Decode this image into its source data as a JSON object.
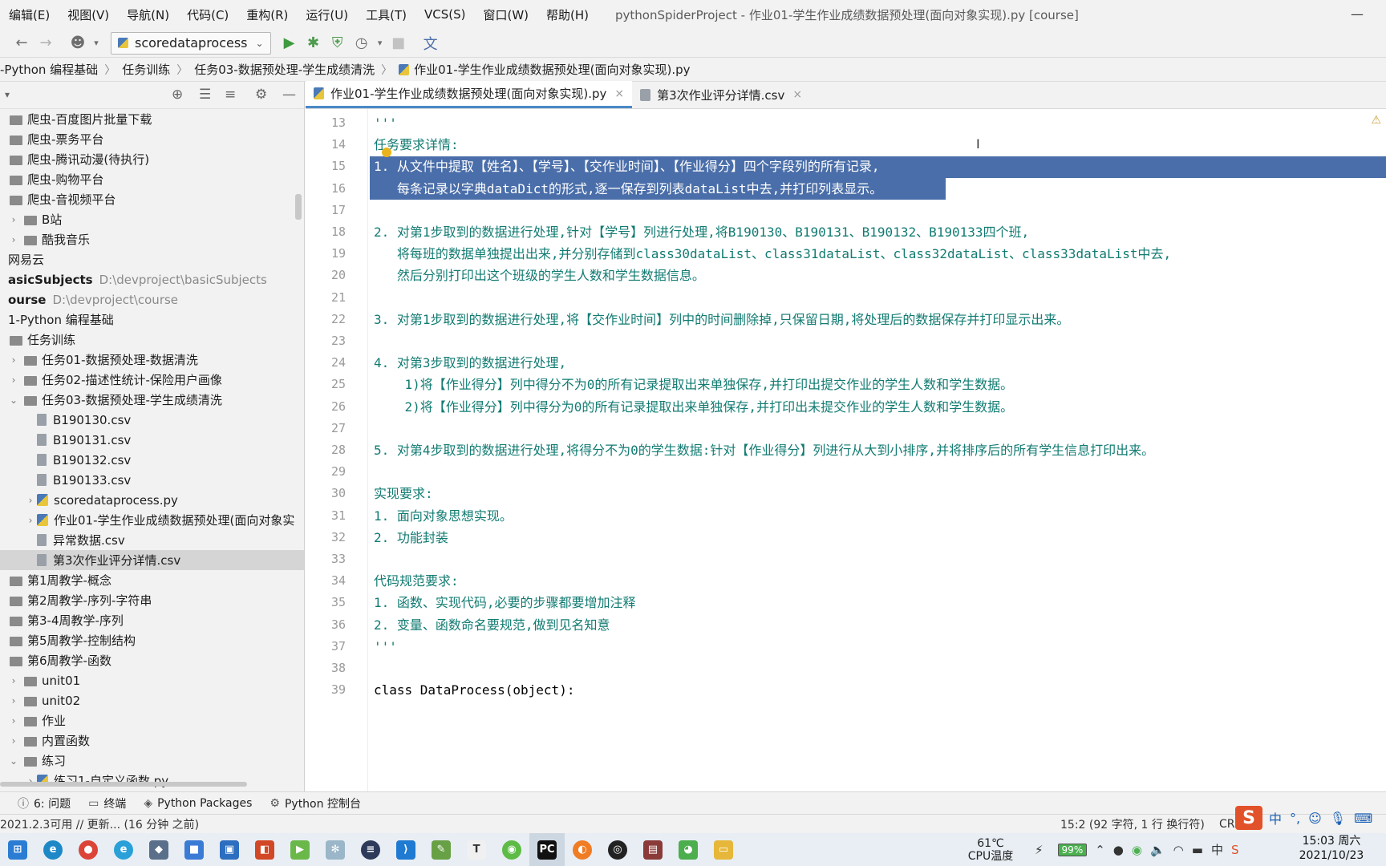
{
  "menubar": {
    "items": [
      "编辑(E)",
      "视图(V)",
      "导航(N)",
      "代码(C)",
      "重构(R)",
      "运行(U)",
      "工具(T)",
      "VCS(S)",
      "窗口(W)",
      "帮助(H)"
    ],
    "title": "pythonSpiderProject - 作业01-学生作业成绩数据预处理(面向对象实现).py [course]",
    "minimize": "—"
  },
  "toolbar": {
    "run_config": "scoredataprocess"
  },
  "breadcrumb": [
    "-Python 编程基础",
    "任务训练",
    "任务03-数据预处理-学生成绩清洗",
    "作业01-学生作业成绩数据预处理(面向对象实现).py"
  ],
  "project_tree": [
    {
      "label": "爬虫-百度图片批量下载",
      "indent": 0,
      "type": "folder",
      "arrow": ""
    },
    {
      "label": "爬虫-票务平台",
      "indent": 0,
      "type": "folder",
      "arrow": ""
    },
    {
      "label": "爬虫-腾讯动漫(待执行)",
      "indent": 0,
      "type": "folder",
      "arrow": ""
    },
    {
      "label": "爬虫-购物平台",
      "indent": 0,
      "type": "folder",
      "arrow": ""
    },
    {
      "label": "爬虫-音视频平台",
      "indent": 0,
      "type": "folder",
      "arrow": ""
    },
    {
      "label": "B站",
      "indent": 1,
      "type": "folder",
      "arrow": "›"
    },
    {
      "label": "酷我音乐",
      "indent": 1,
      "type": "folder",
      "arrow": "›"
    },
    {
      "label": "网易云",
      "indent": 0,
      "type": "plain",
      "arrow": ""
    },
    {
      "label": "asicSubjects",
      "indent": 0,
      "type": "root",
      "arrow": "",
      "path": "D:\\devproject\\basicSubjects"
    },
    {
      "label": "ourse",
      "indent": 0,
      "type": "root",
      "arrow": "",
      "path": "D:\\devproject\\course"
    },
    {
      "label": "1-Python 编程基础",
      "indent": 0,
      "type": "plain",
      "arrow": ""
    },
    {
      "label": "任务训练",
      "indent": 0,
      "type": "folder",
      "arrow": ""
    },
    {
      "label": "任务01-数据预处理-数据清洗",
      "indent": 1,
      "type": "folder",
      "arrow": "›"
    },
    {
      "label": "任务02-描述性统计-保险用户画像",
      "indent": 1,
      "type": "folder",
      "arrow": "›"
    },
    {
      "label": "任务03-数据预处理-学生成绩清洗",
      "indent": 1,
      "type": "folder",
      "arrow": "⌄"
    },
    {
      "label": "B190130.csv",
      "indent": 2,
      "type": "file",
      "arrow": ""
    },
    {
      "label": "B190131.csv",
      "indent": 2,
      "type": "file",
      "arrow": ""
    },
    {
      "label": "B190132.csv",
      "indent": 2,
      "type": "file",
      "arrow": ""
    },
    {
      "label": "B190133.csv",
      "indent": 2,
      "type": "file",
      "arrow": ""
    },
    {
      "label": "scoredataprocess.py",
      "indent": 2,
      "type": "py",
      "arrow": "›"
    },
    {
      "label": "作业01-学生作业成绩数据预处理(面向对象实",
      "indent": 2,
      "type": "py",
      "arrow": "›"
    },
    {
      "label": "异常数据.csv",
      "indent": 2,
      "type": "file",
      "arrow": ""
    },
    {
      "label": "第3次作业评分详情.csv",
      "indent": 2,
      "type": "file",
      "arrow": "",
      "selected": true
    },
    {
      "label": "第1周教学-概念",
      "indent": 0,
      "type": "folder",
      "arrow": ""
    },
    {
      "label": "第2周教学-序列-字符串",
      "indent": 0,
      "type": "folder",
      "arrow": ""
    },
    {
      "label": "第3-4周教学-序列",
      "indent": 0,
      "type": "folder",
      "arrow": ""
    },
    {
      "label": "第5周教学-控制结构",
      "indent": 0,
      "type": "folder",
      "arrow": ""
    },
    {
      "label": "第6周教学-函数",
      "indent": 0,
      "type": "folder",
      "arrow": ""
    },
    {
      "label": "unit01",
      "indent": 1,
      "type": "folder",
      "arrow": "›"
    },
    {
      "label": "unit02",
      "indent": 1,
      "type": "folder",
      "arrow": "›"
    },
    {
      "label": "作业",
      "indent": 1,
      "type": "folder",
      "arrow": "›"
    },
    {
      "label": "内置函数",
      "indent": 1,
      "type": "folder",
      "arrow": "›"
    },
    {
      "label": "练习",
      "indent": 1,
      "type": "folder",
      "arrow": "⌄"
    },
    {
      "label": "练习1-自定义函数.py",
      "indent": 2,
      "type": "py",
      "arrow": "›"
    }
  ],
  "tabs": [
    {
      "label": "作业01-学生作业成绩数据预处理(面向对象实现).py",
      "active": true
    },
    {
      "label": "第3次作业评分详情.csv",
      "active": false
    }
  ],
  "code_lines": [
    {
      "num": "13",
      "text": "'''",
      "style": "str"
    },
    {
      "num": "14",
      "text": "任务要求详情:",
      "style": "str"
    },
    {
      "num": "15",
      "text": "1. 从文件中提取【姓名】、【学号】、【交作业时间】、【作业得分】四个字段列的所有记录,",
      "style": "sel-full"
    },
    {
      "num": "16",
      "text": "   每条记录以字典dataDict的形式,逐一保存到列表dataList中去,并打印列表显示。",
      "style": "sel-part"
    },
    {
      "num": "17",
      "text": "",
      "style": "str"
    },
    {
      "num": "18",
      "text": "2. 对第1步取到的数据进行处理,针对【学号】列进行处理,将B190130、B190131、B190132、B190133四个班,",
      "style": "str"
    },
    {
      "num": "19",
      "text": "   将每班的数据单独提出出来,并分别存储到class30dataList、class31dataList、class32dataList、class33dataList中去,",
      "style": "str"
    },
    {
      "num": "20",
      "text": "   然后分别打印出这个班级的学生人数和学生数据信息。",
      "style": "str"
    },
    {
      "num": "21",
      "text": "",
      "style": "str"
    },
    {
      "num": "22",
      "text": "3. 对第1步取到的数据进行处理,将【交作业时间】列中的时间删除掉,只保留日期,将处理后的数据保存并打印显示出来。",
      "style": "str"
    },
    {
      "num": "23",
      "text": "",
      "style": "str"
    },
    {
      "num": "24",
      "text": "4. 对第3步取到的数据进行处理,",
      "style": "str"
    },
    {
      "num": "25",
      "text": "    1)将【作业得分】列中得分不为0的所有记录提取出来单独保存,并打印出提交作业的学生人数和学生数据。",
      "style": "str"
    },
    {
      "num": "26",
      "text": "    2)将【作业得分】列中得分为0的所有记录提取出来单独保存,并打印出未提交作业的学生人数和学生数据。",
      "style": "str"
    },
    {
      "num": "27",
      "text": "",
      "style": "str"
    },
    {
      "num": "28",
      "text": "5. 对第4步取到的数据进行处理,将得分不为0的学生数据:针对【作业得分】列进行从大到小排序,并将排序后的所有学生信息打印出来。",
      "style": "str"
    },
    {
      "num": "29",
      "text": "",
      "style": "str"
    },
    {
      "num": "30",
      "text": "实现要求:",
      "style": "str"
    },
    {
      "num": "31",
      "text": "1. 面向对象思想实现。",
      "style": "str"
    },
    {
      "num": "32",
      "text": "2. 功能封装",
      "style": "str"
    },
    {
      "num": "33",
      "text": "",
      "style": "str"
    },
    {
      "num": "34",
      "text": "代码规范要求:",
      "style": "str"
    },
    {
      "num": "35",
      "text": "1. 函数、实现代码,必要的步骤都要增加注释",
      "style": "str"
    },
    {
      "num": "36",
      "text": "2. 变量、函数命名要规范,做到见名知意",
      "style": "str"
    },
    {
      "num": "37",
      "text": "'''",
      "style": "str"
    },
    {
      "num": "38",
      "text": "",
      "style": "str"
    },
    {
      "num": "39",
      "text": "class DataProcess(object):",
      "style": "kw"
    }
  ],
  "bottom_tools": [
    "6: 问题",
    "终端",
    "Python Packages",
    "Python 控制台"
  ],
  "statusbar": {
    "message": "2021.2.3可用 // 更新... (16 分钟 之前)",
    "position": "15:2 (92 字符, 1 行 换行符)",
    "line_sep": "CRL"
  },
  "taskbar": {
    "temp": "61℃",
    "temp_label": "CPU温度",
    "battery": "99%",
    "time": "15:03 周六",
    "date": "2021/10/23"
  },
  "ime": {
    "lang": "中"
  },
  "colors": {
    "string": "#117b72",
    "selection": "#4a6ea9",
    "keyword": "#000080"
  }
}
